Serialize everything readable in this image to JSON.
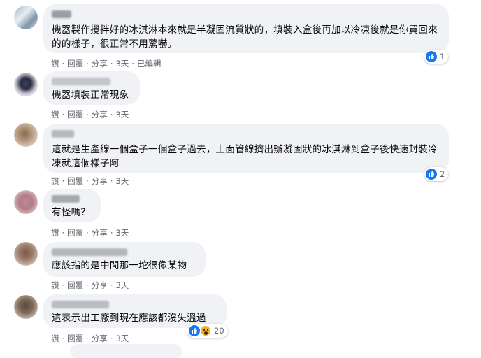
{
  "comments": [
    {
      "text": "機器製作攪拌好的冰淇淋本來就是半凝固流質狀的，填裝入盒後再加以冷凍後就是你買回來的的樣子，很正常不用驚嚇。",
      "actions": [
        "讚",
        "回覆",
        "分享",
        "3天",
        "已編輯"
      ],
      "reaction_count": "1",
      "reactions": [
        "like-icon"
      ]
    },
    {
      "text": "機器填裝正常現象",
      "actions": [
        "讚",
        "回覆",
        "分享",
        "3天"
      ]
    },
    {
      "text": "這就是生產線一個盒子一個盒子過去，上面管線擠出辦凝固狀的冰淇淋到盒子後快速封裝冷凍就這個樣子阿",
      "actions": [
        "讚",
        "回覆",
        "分享",
        "3天"
      ],
      "reaction_count": "2",
      "reactions": [
        "like-icon"
      ]
    },
    {
      "text": "有怪嗎？",
      "actions": [
        "讚",
        "回覆",
        "分享",
        "3天"
      ]
    },
    {
      "text": "應該指的是中間那一坨很像某物",
      "actions": [
        "讚",
        "回覆",
        "分享",
        "3天"
      ]
    },
    {
      "text": "這表示出工廠到現在應該都沒失溫過",
      "actions": [
        "讚",
        "回覆",
        "分享",
        "3天"
      ],
      "reaction_count": "20",
      "reactions": [
        "like-icon",
        "wow-icon"
      ]
    }
  ],
  "colors": {
    "bubble_bg": "#f0f2f5",
    "meta_text": "#65676b",
    "like_blue": "#1877f2"
  }
}
